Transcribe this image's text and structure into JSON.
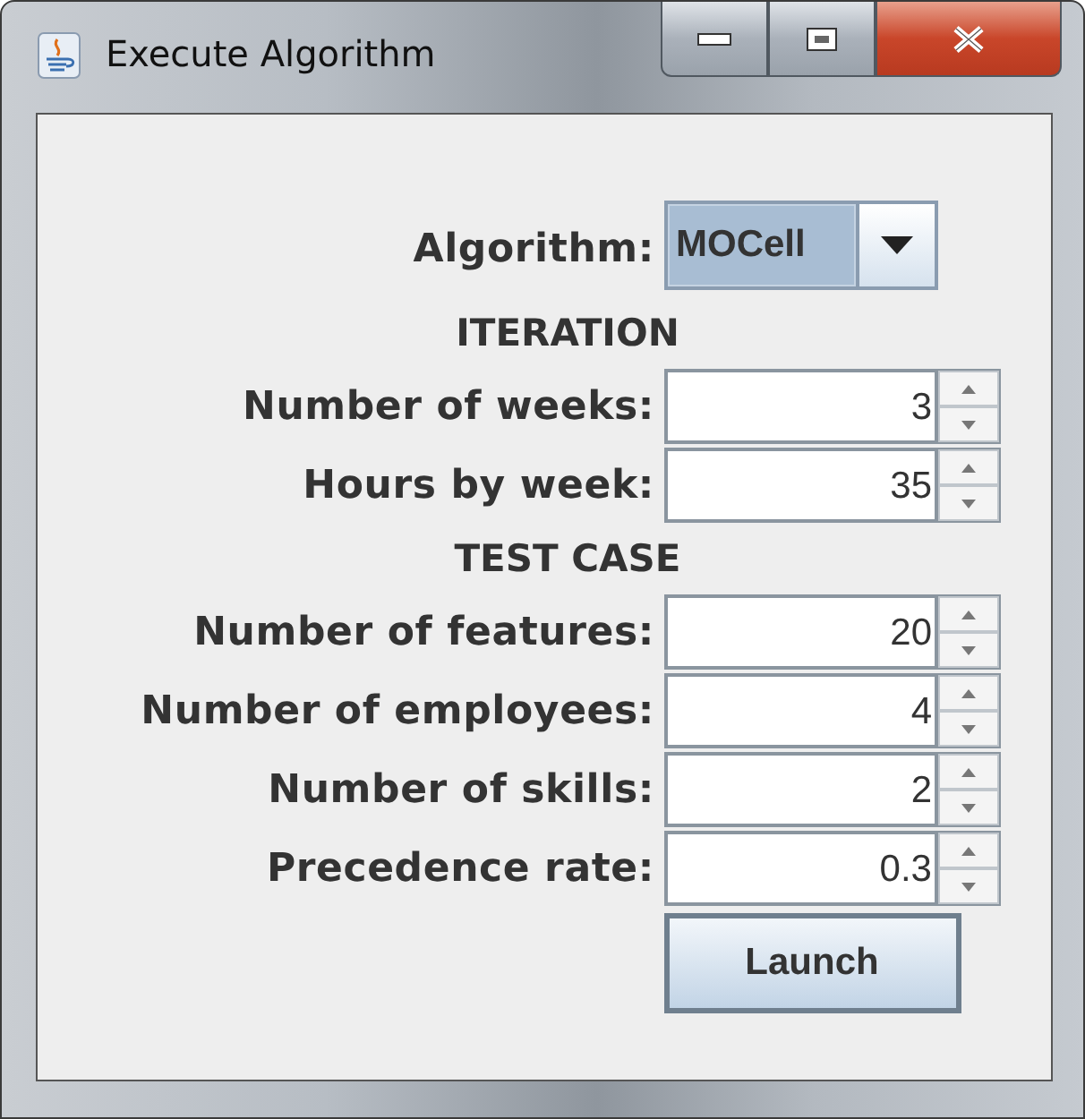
{
  "window": {
    "title": "Execute Algorithm"
  },
  "algorithm": {
    "label": "Algorithm:",
    "value": "MOCell"
  },
  "sections": [
    {
      "heading": "ITERATION",
      "fields": [
        {
          "label": "Number of weeks:",
          "value": "3"
        },
        {
          "label": "Hours by week:",
          "value": "35"
        }
      ]
    },
    {
      "heading": "TEST CASE",
      "fields": [
        {
          "label": "Number of features:",
          "value": "20"
        },
        {
          "label": "Number of employees:",
          "value": "4"
        },
        {
          "label": "Number of skills:",
          "value": "2"
        },
        {
          "label": "Precedence rate:",
          "value": "0.3"
        }
      ]
    }
  ],
  "buttons": [
    "Launch"
  ]
}
